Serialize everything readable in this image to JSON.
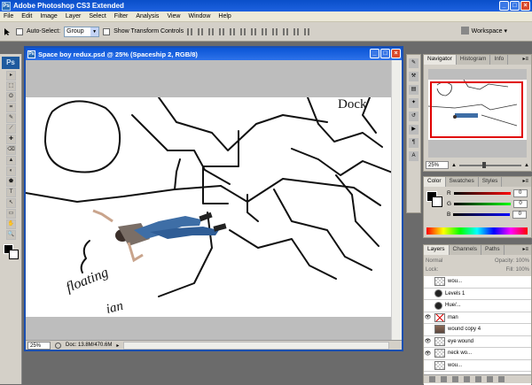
{
  "app": {
    "title": "Adobe Photoshop CS3 Extended",
    "icon_text": "Ps"
  },
  "window_controls": {
    "minimize": "_",
    "maximize": "□",
    "close": "×"
  },
  "menu": [
    "File",
    "Edit",
    "Image",
    "Layer",
    "Select",
    "Filter",
    "Analysis",
    "View",
    "Window",
    "Help"
  ],
  "options": {
    "auto_select_label": "Auto-Select:",
    "auto_select_value": "Group",
    "show_transform_label": "Show Transform Controls",
    "workspace_label": "Workspace ▾"
  },
  "tools": [
    "▸",
    "⬚",
    "ʘ",
    "⌗",
    "✎",
    "⟋",
    "✚",
    "⌫",
    "▲",
    "◐",
    "⬟",
    "T",
    "↖",
    "▭",
    "✋",
    "🔍"
  ],
  "document": {
    "title": "Space boy redux.psd @ 25% (Spaceship 2, RGB/8)",
    "zoom": "25%",
    "doc_info": "Doc: 13.8M/470.6M"
  },
  "navigator": {
    "tabs": [
      "Navigator",
      "Histogram",
      "Info"
    ],
    "zoom": "25%"
  },
  "color_panel": {
    "tabs": [
      "Color",
      "Swatches",
      "Styles"
    ],
    "channels": [
      {
        "label": "R",
        "value": "0",
        "gradient": "#000000,#ff0000"
      },
      {
        "label": "G",
        "value": "0",
        "gradient": "#000000,#00ff00"
      },
      {
        "label": "B",
        "value": "0",
        "gradient": "#000000,#0000ff"
      }
    ]
  },
  "layers_panel": {
    "tabs": [
      "Layers",
      "Channels",
      "Paths"
    ],
    "blend_mode": "Normal",
    "opacity_label": "Opacity:",
    "opacity_value": "100%",
    "lock_label": "Lock:",
    "fill_label": "Fill:",
    "fill_value": "100%",
    "layers": [
      {
        "name": "wou...",
        "thumb": "checker",
        "visible": ""
      },
      {
        "name": "Levels 1",
        "thumb": "adj",
        "visible": ""
      },
      {
        "name": "Hue/...",
        "thumb": "adj",
        "visible": ""
      },
      {
        "name": "man",
        "thumb": "mask-x",
        "visible": "👁"
      },
      {
        "name": "wound copy 4",
        "thumb": "photo",
        "visible": ""
      },
      {
        "name": "eye wound",
        "thumb": "checker",
        "visible": "👁"
      },
      {
        "name": "neck wo...",
        "thumb": "checker",
        "visible": "👁"
      },
      {
        "name": "wou...",
        "thumb": "checker",
        "visible": ""
      }
    ]
  },
  "canvas_text": {
    "doodle_1": "floating",
    "doodle_2": "ian",
    "doodle_3": "Dock"
  }
}
